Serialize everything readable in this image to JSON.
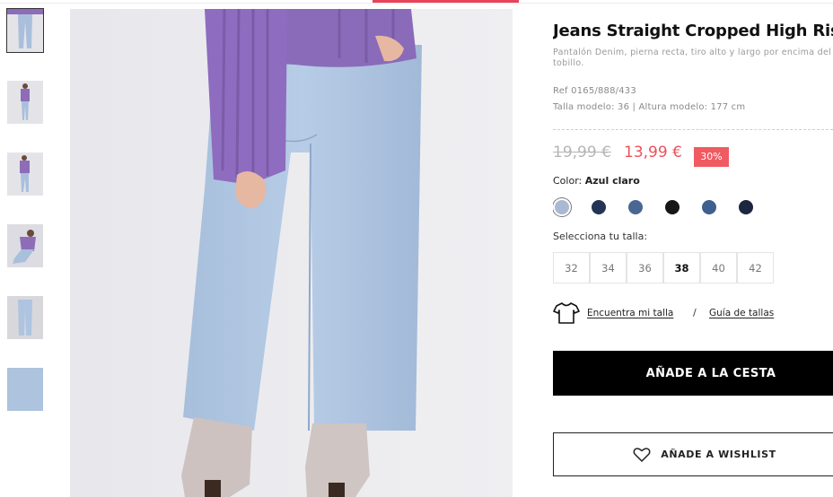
{
  "product": {
    "title": "Jeans Straight Cropped High Rise",
    "subtitle": "Pantalón Denim, pierna recta, tiro alto y largo por encima del tobillo.",
    "ref": "Ref 0165/888/433",
    "model_info": "Talla modelo: 36 | Altura modelo: 177 cm",
    "price_old": "19,99 €",
    "price_new": "13,99 €",
    "discount": "30%"
  },
  "color": {
    "label": "Color:",
    "value": "Azul claro",
    "swatches": [
      {
        "name": "azul-claro",
        "hex": "#a9b9d4",
        "selected": true
      },
      {
        "name": "azul-marino",
        "hex": "#233457"
      },
      {
        "name": "azul-medio",
        "hex": "#4a6692"
      },
      {
        "name": "negro",
        "hex": "#161616"
      },
      {
        "name": "azul",
        "hex": "#3f5f8e"
      },
      {
        "name": "azul-oscuro",
        "hex": "#1c2640"
      }
    ]
  },
  "sizes": {
    "label": "Selecciona tu talla:",
    "options": [
      "32",
      "34",
      "36",
      "38",
      "40",
      "42"
    ],
    "selected": "38"
  },
  "fit": {
    "find_size": "Encuentra mi talla",
    "separator": "/",
    "size_guide": "Guía de tallas",
    "icon": "tshirt-icon"
  },
  "actions": {
    "add_to_cart": "AÑADE A LA CESTA",
    "add_to_wishlist": "AÑADE A WISHLIST",
    "wishlist_icon": "heart-icon"
  },
  "colors": {
    "accent": "#e8435a",
    "sale": "#ef4f5a",
    "discount_bg": "#f05a62"
  }
}
